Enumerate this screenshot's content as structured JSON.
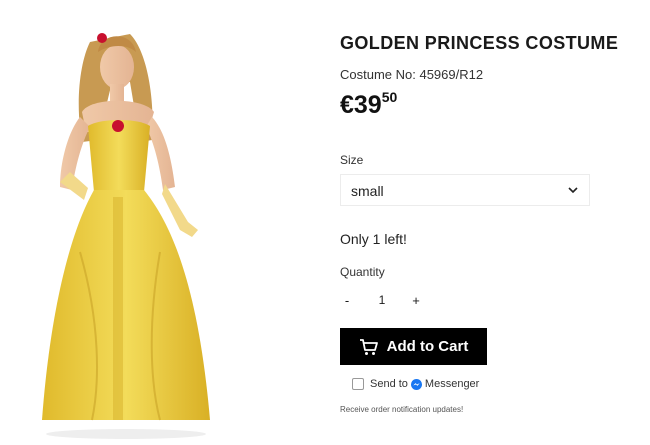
{
  "product": {
    "image_alt": "Woman wearing a yellow gold princess gown",
    "title": "GOLDEN PRINCESS COSTUME",
    "sku": "Costume No: 45969/R12",
    "price": {
      "main": "€39",
      "cents": "50"
    }
  },
  "size": {
    "label": "Size",
    "selected": "small"
  },
  "stock_text": "Only 1 left!",
  "quantity": {
    "label": "Quantity",
    "minus": "-",
    "value": "1",
    "plus": "+"
  },
  "cart": {
    "label": "Add to Cart"
  },
  "messenger": {
    "send_label": "Send to",
    "messenger_label": "Messenger",
    "note": "Receive order notification updates!"
  },
  "colors": {
    "button_bg": "#000000",
    "gown": "#e7c93a",
    "messenger_blue": "#1877f2"
  },
  "icons": {
    "cart": "cart-icon",
    "chevron": "chevron-down-icon",
    "messenger": "messenger-icon"
  }
}
